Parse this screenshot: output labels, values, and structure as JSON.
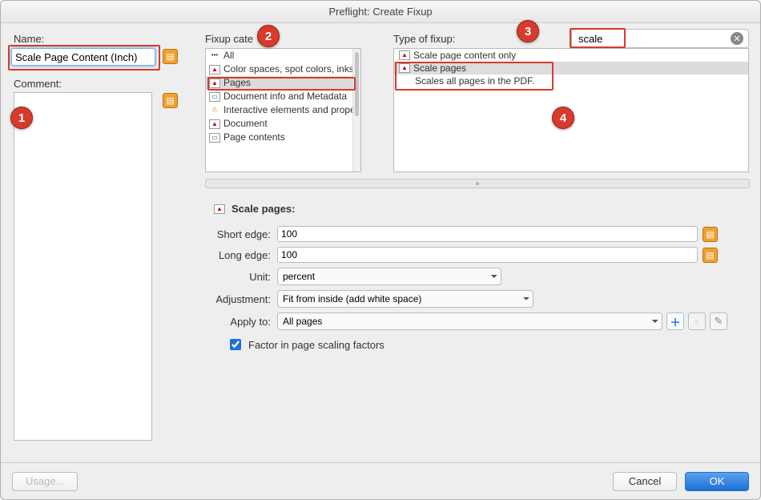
{
  "title": "Preflight: Create Fixup",
  "name_label": "Name:",
  "name_value": "Scale Page Content (Inch)",
  "comment_label": "Comment:",
  "comment_value": "",
  "cat_label": "Fixup cate",
  "type_label": "Type of fixup:",
  "search_value": "scale",
  "categories": [
    {
      "label": "All",
      "ico": "dots"
    },
    {
      "label": "Color spaces, spot colors, inks",
      "ico": "pdf"
    },
    {
      "label": "Pages",
      "ico": "pdf",
      "selected": true
    },
    {
      "label": "Document info and Metadata",
      "ico": "doc"
    },
    {
      "label": "Interactive elements and proper",
      "ico": "warn"
    },
    {
      "label": "Document",
      "ico": "pdf"
    },
    {
      "label": "Page contents",
      "ico": "doc"
    }
  ],
  "types": [
    {
      "label": "Scale page content only"
    },
    {
      "label": "Scale pages",
      "selected": true,
      "desc": "Scales all pages in the PDF."
    }
  ],
  "section_title": "Scale pages:",
  "params": {
    "short_label": "Short edge:",
    "short_value": "100",
    "long_label": "Long edge:",
    "long_value": "100",
    "unit_label": "Unit:",
    "unit_value": "percent",
    "adj_label": "Adjustment:",
    "adj_value": "Fit from inside (add white space)",
    "apply_label": "Apply to:",
    "apply_value": "All pages",
    "checkbox_label": "Factor in page scaling factors",
    "checkbox_checked": true
  },
  "buttons": {
    "usage": "Usage...",
    "cancel": "Cancel",
    "ok": "OK"
  },
  "callouts": {
    "c1": "1",
    "c2": "2",
    "c3": "3",
    "c4": "4"
  }
}
